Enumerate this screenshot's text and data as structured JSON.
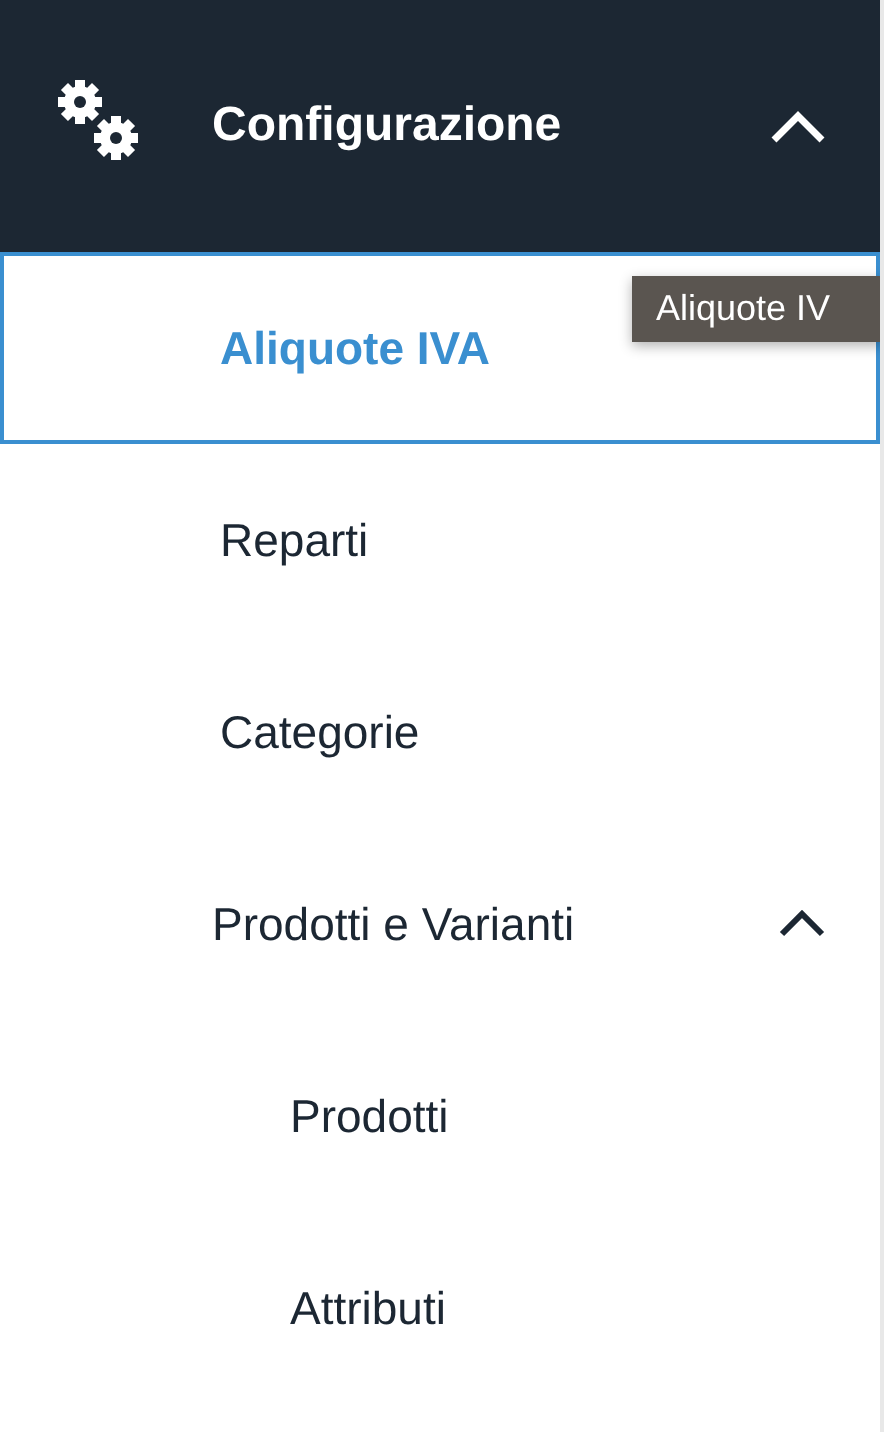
{
  "header": {
    "title": "Configurazione",
    "expanded": true
  },
  "items": [
    {
      "label": "Aliquote IVA",
      "selected": true
    },
    {
      "label": "Reparti",
      "selected": false
    },
    {
      "label": "Categorie",
      "selected": false
    },
    {
      "label": "Prodotti e Varianti",
      "selected": false,
      "expanded": true,
      "children": [
        {
          "label": "Prodotti",
          "selected": false
        },
        {
          "label": "Attributi",
          "selected": false
        }
      ]
    }
  ],
  "tooltip": {
    "text": "Aliquote IV"
  }
}
